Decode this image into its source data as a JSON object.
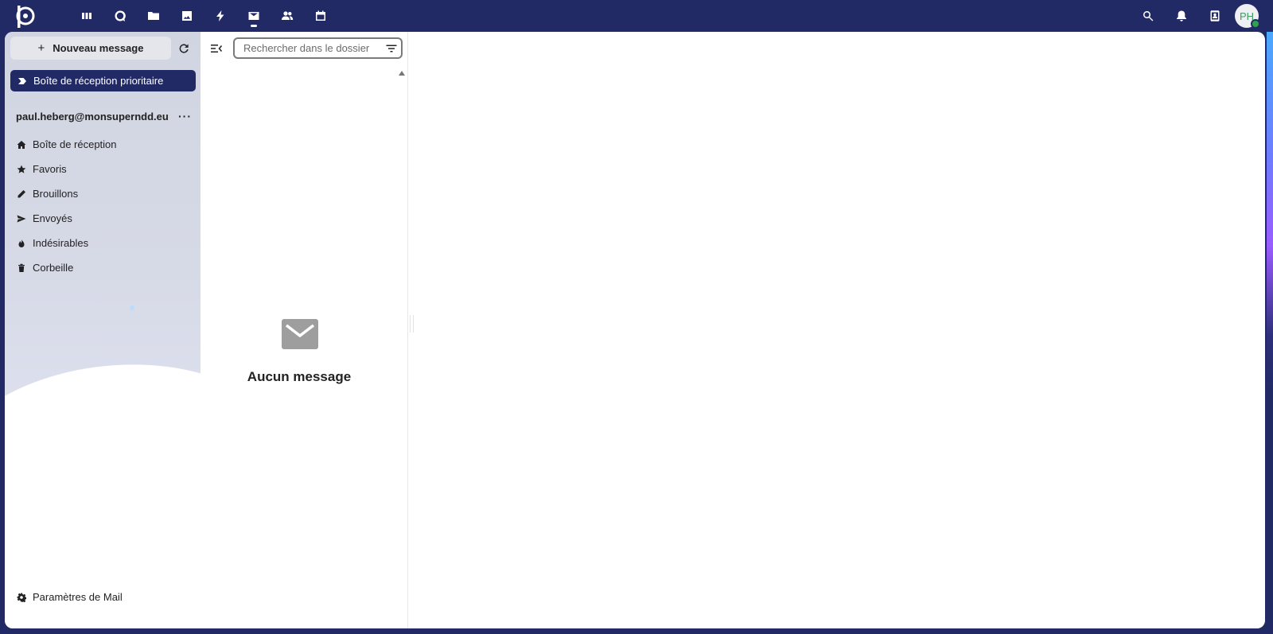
{
  "topbar": {
    "logo": "nextcloud-logo",
    "apps": [
      {
        "name": "dashboard",
        "icon": "dashboard-icon",
        "active": false
      },
      {
        "name": "talk",
        "icon": "talk-icon",
        "active": false
      },
      {
        "name": "files",
        "icon": "folder-icon",
        "active": false
      },
      {
        "name": "photos",
        "icon": "image-icon",
        "active": false
      },
      {
        "name": "activity",
        "icon": "lightning-icon",
        "active": false
      },
      {
        "name": "mail",
        "icon": "mail-icon",
        "active": true
      },
      {
        "name": "contacts",
        "icon": "contacts-icon",
        "active": false
      },
      {
        "name": "calendar",
        "icon": "calendar-icon",
        "active": false
      }
    ],
    "right": [
      "search-icon",
      "bell-icon",
      "contacts-menu-icon"
    ],
    "avatar_initials": "PH",
    "colors": {
      "bar": "#222a66",
      "avatar_text": "#3f9a63",
      "status": "#2ca24d"
    }
  },
  "sidebar": {
    "new_message_label": "Nouveau message",
    "priority_inbox_label": "Boîte de réception prioritaire",
    "account": "paul.heberg@monsuperndd.eu",
    "account_menu": "···",
    "folders": [
      {
        "label": "Boîte de réception",
        "icon": "home-icon"
      },
      {
        "label": "Favoris",
        "icon": "star-icon"
      },
      {
        "label": "Brouillons",
        "icon": "pencil-icon"
      },
      {
        "label": "Envoyés",
        "icon": "send-icon"
      },
      {
        "label": "Indésirables",
        "icon": "fire-icon"
      },
      {
        "label": "Corbeille",
        "icon": "trash-icon"
      }
    ],
    "settings_label": "Paramètres de Mail"
  },
  "message_list": {
    "search_placeholder": "Rechercher dans le dossier",
    "search_value": "",
    "empty_title": "Aucun message"
  }
}
